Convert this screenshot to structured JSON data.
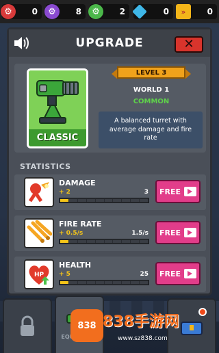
{
  "currencies": [
    {
      "icon": "red-gear-icon",
      "color": "#d83a3a",
      "value": "0"
    },
    {
      "icon": "purple-gear-icon",
      "color": "#8a4ad0",
      "value": "8"
    },
    {
      "icon": "green-gear-icon",
      "color": "#4bb84a",
      "value": "2"
    },
    {
      "icon": "blue-gem-icon",
      "color": "#3fb7e8",
      "value": "0"
    },
    {
      "icon": "yellow-ticket-icon",
      "color": "#f3b519",
      "value": "0"
    }
  ],
  "panel": {
    "title": "UPGRADE",
    "close_label": "✕"
  },
  "turret": {
    "name": "CLASSIC",
    "level": "LEVEL 3",
    "world": "WORLD 1",
    "rarity": "COMMON",
    "description": "A balanced turret with average damage and fire rate"
  },
  "statistics": {
    "title": "STATISTICS",
    "free_label": "FREE",
    "rows": [
      {
        "name": "DAMAGE",
        "increment": "+ 2",
        "current": "3",
        "icon": "damage-icon",
        "progress_segments": 1,
        "total_segments": 10
      },
      {
        "name": "FIRE RATE",
        "increment": "+ 0.5/s",
        "current": "1.5/s",
        "icon": "fire-rate-icon",
        "progress_segments": 1,
        "total_segments": 10
      },
      {
        "name": "HEALTH",
        "increment": "+ 5",
        "current": "25",
        "icon": "health-icon",
        "progress_segments": 1,
        "total_segments": 10
      }
    ]
  },
  "nav": {
    "equipment_label": "EQUIPMENT"
  },
  "watermark": {
    "brand": "838手游网",
    "url": "www.sz838.com",
    "logo_text": "838"
  },
  "colors": {
    "accent_free": "#e23d8a",
    "level_ribbon": "#f0a21b",
    "card_green": "#4aa63a",
    "rarity_green": "#5fd34a",
    "stat_yellow": "#f5c519"
  }
}
